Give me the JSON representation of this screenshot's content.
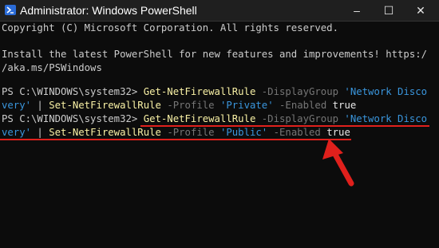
{
  "window": {
    "title": "Administrator: Windows PowerShell",
    "controls": {
      "minimize": "–",
      "maximize": "☐",
      "close": "✕"
    }
  },
  "console": {
    "copyright": "Copyright (C) Microsoft Corporation. All rights reserved.",
    "install_line1": "Install the latest PowerShell for new features and improvements! https:/",
    "install_line2": "/aka.ms/PSWindows",
    "cmd1": {
      "prompt": "PS C:\\WINDOWS\\system32> ",
      "cmdlet1": "Get-NetFirewallRule",
      "param1": " -DisplayGroup ",
      "arg1a": "'Network Disco",
      "arg1b": "very'",
      "pipe": " | ",
      "cmdlet2": "Set-NetFirewallRule",
      "param2": " -Profile ",
      "arg2": "'Private'",
      "param3": " -Enabled ",
      "arg3": "true"
    },
    "cmd2": {
      "prompt": "PS C:\\WINDOWS\\system32> ",
      "cmdlet1": "Get-NetFirewallRule",
      "param1": " -DisplayGroup ",
      "arg1a": "'Network Disco",
      "arg1b": "very'",
      "pipe": " | ",
      "cmdlet2": "Set-NetFirewallRule",
      "param2": " -Profile ",
      "arg2": "'Public'",
      "param3": " -Enabled ",
      "arg3": "true"
    }
  },
  "colors": {
    "cmdlet": "#f9f1a5",
    "parameter": "#767676",
    "string": "#3a96dd",
    "annotation": "#e0201c"
  },
  "icons": [
    "powershell-icon",
    "arrow-annotation-icon"
  ]
}
